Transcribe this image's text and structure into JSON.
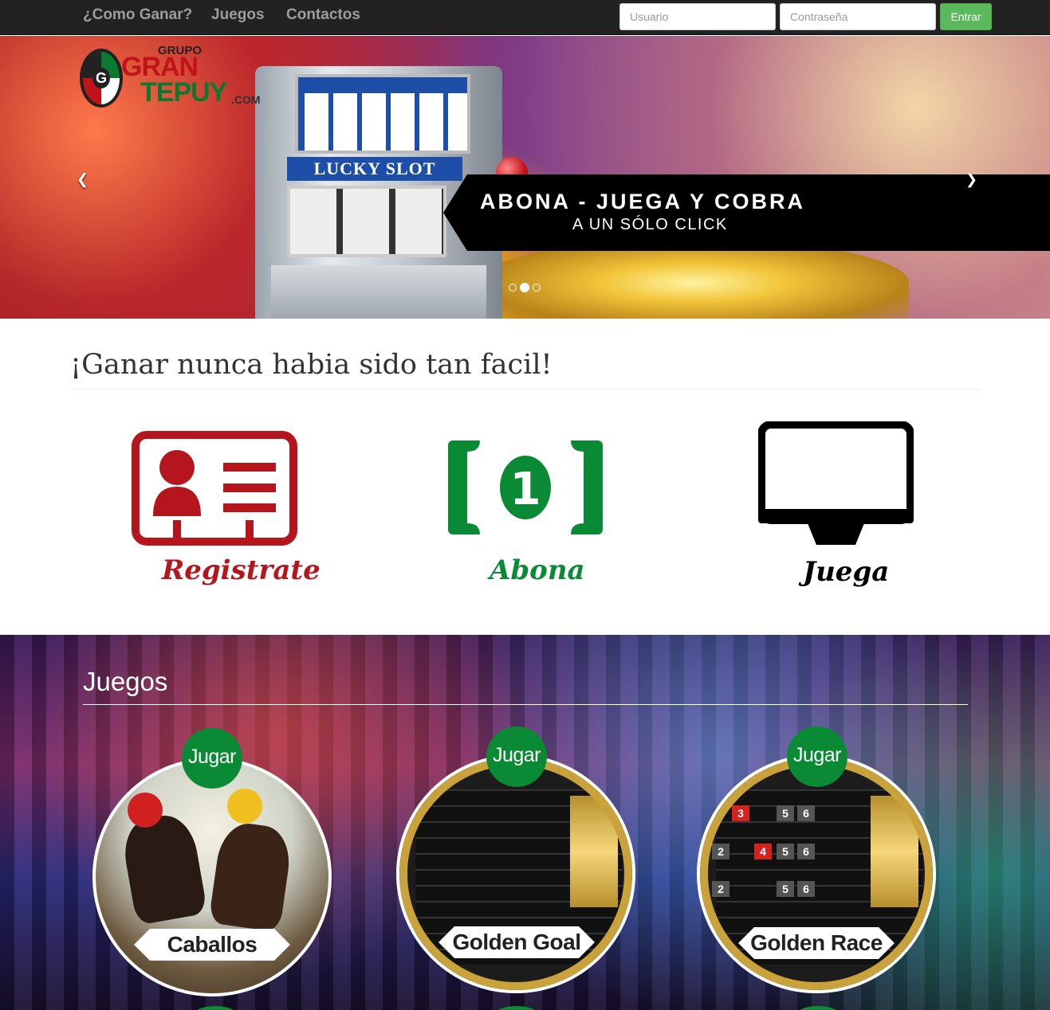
{
  "nav": {
    "links": [
      "¿Como Ganar?",
      "Juegos",
      "Contactos"
    ],
    "username_placeholder": "Usuario",
    "password_placeholder": "Contraseña",
    "login_button": "Entrar"
  },
  "logo": {
    "grupo": "GRUPO",
    "gran": "GRAN",
    "tepuy": "TEPUY",
    "com": ".COM"
  },
  "carousel": {
    "machine_label": "LUCKY SLOT",
    "headline": "ABONA - JUEGA Y COBRA",
    "subline": "A UN SÓLO CLICK",
    "prev_icon": "chevron-left-icon",
    "next_icon": "chevron-right-icon",
    "active_slide": 2,
    "slide_count": 3
  },
  "steps": {
    "title": "¡Ganar nunca habia sido tan facil!",
    "items": [
      {
        "label": "Registrate",
        "icon": "id-card-icon",
        "color": "#b5161e"
      },
      {
        "label": "Abona",
        "icon": "banknote-icon",
        "color": "#0b8a35"
      },
      {
        "label": "Juega",
        "icon": "monitor-icon",
        "color": "#000000"
      }
    ]
  },
  "juegos": {
    "title": "Juegos",
    "play_label": "Jugar",
    "games": [
      {
        "name": "Caballos"
      },
      {
        "name": "Golden Goal"
      },
      {
        "name": "Golden Race"
      }
    ]
  },
  "colors": {
    "nav_bg": "#222222",
    "accent_green": "#5cb85c",
    "jugar_green": "#0b8a35"
  }
}
